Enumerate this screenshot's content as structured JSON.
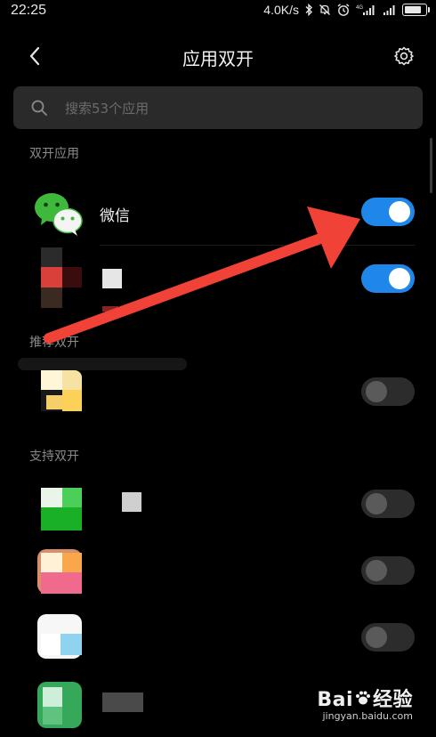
{
  "status_bar": {
    "time": "22:25",
    "network_speed": "4.0K/s",
    "network_type": "4G",
    "icons": [
      "bluetooth-icon",
      "mute-icon",
      "alarm-icon",
      "signal-icon",
      "wifi-icon",
      "battery-icon"
    ]
  },
  "header": {
    "title": "应用双开",
    "back_icon": "chevron-left-icon",
    "settings_icon": "gear-icon"
  },
  "search": {
    "placeholder": "搜索53个应用",
    "value": ""
  },
  "sections": {
    "dual_apps": "双开应用",
    "recommended": "推荐双开",
    "supported": "支持双开"
  },
  "apps": {
    "dual": [
      {
        "name": "微信",
        "enabled": true
      },
      {
        "name": "",
        "enabled": true
      }
    ],
    "recommended": [
      {
        "name": "",
        "enabled": false
      }
    ],
    "supported": [
      {
        "name": "",
        "enabled": false
      },
      {
        "name": "",
        "enabled": false
      },
      {
        "name": "",
        "enabled": false
      },
      {
        "name": "",
        "enabled": false
      }
    ]
  },
  "colors": {
    "background": "#000000",
    "toggle_on": "#1f87e9",
    "toggle_off": "#2c2c2c",
    "annotation_arrow": "#f04236",
    "wechat_green": "#3fb93c"
  },
  "watermark": {
    "brand_left": "Bai",
    "brand_right": "经验",
    "url": "jingyan.baidu.com"
  }
}
